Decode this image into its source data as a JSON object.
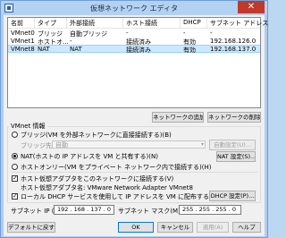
{
  "window": {
    "title": "仮想ネットワーク エディタ",
    "close": "✕"
  },
  "table": {
    "headers": [
      "名前",
      "タイプ",
      "外部接続",
      "ホスト接続",
      "DHCP",
      "サブネット アドレス"
    ],
    "rows": [
      [
        "VMnet0",
        "ブリッジ",
        "自動ブリッジ",
        "-",
        "-",
        "-"
      ],
      [
        "VMnet1",
        "ホストオ...",
        "-",
        "接続済み",
        "有効",
        "192.168.126.0"
      ],
      [
        "VMnet8",
        "NAT",
        "NAT",
        "接続済み",
        "有効",
        "192.168.137.0"
      ]
    ],
    "selected_row": 2
  },
  "buttons": {
    "add_network": "ネットワークの追加(E)...",
    "remove_network": "ネットワークの削除(O)",
    "nat_settings": "NAT 設定(S)...",
    "dhcp_settings": "DHCP 設定(P)...",
    "restore_defaults": "デフォルトに戻す(R)",
    "ok": "OK",
    "cancel": "キャンセル",
    "apply": "適用(A)",
    "help": "ヘルプ"
  },
  "vmnet_info": {
    "label": "VMnet 情報",
    "bridge_option": "ブリッジ(VM を外部ネットワークに直接接続する)(B)",
    "bridge_to_label": "ブリッジ先(T):",
    "bridge_to_value": "自動",
    "auto_settings": "自動設定(U)...",
    "nat_option": "NAT(ホストの IP アドレスを VM と共有する)(N)",
    "hostonly_option": "ホストオンリー(VM をプライベート ネットワーク内で接続する)(H)",
    "connect_host_adapter": "ホスト仮想アダプタをこのネットワークに接続する(V)",
    "host_adapter_name": "ホスト仮想アダプタ名: VMware Network Adapter VMnet8",
    "use_local_dhcp": "ローカル DHCP サービスを使用して IP アドレスを VM に配布する(D)",
    "subnet_ip_label": "サブネット IP (I):",
    "subnet_ip_value": "192 . 168 . 137 .  0",
    "subnet_mask_label": "サブネット マスク(M):",
    "subnet_mask_value": "255 . 255 . 255 .  0",
    "selected_mode": "nat"
  },
  "colors": {
    "title_bar": "#b3d1f1",
    "close_button": "#c0392b",
    "selection": "#cce8ff"
  }
}
